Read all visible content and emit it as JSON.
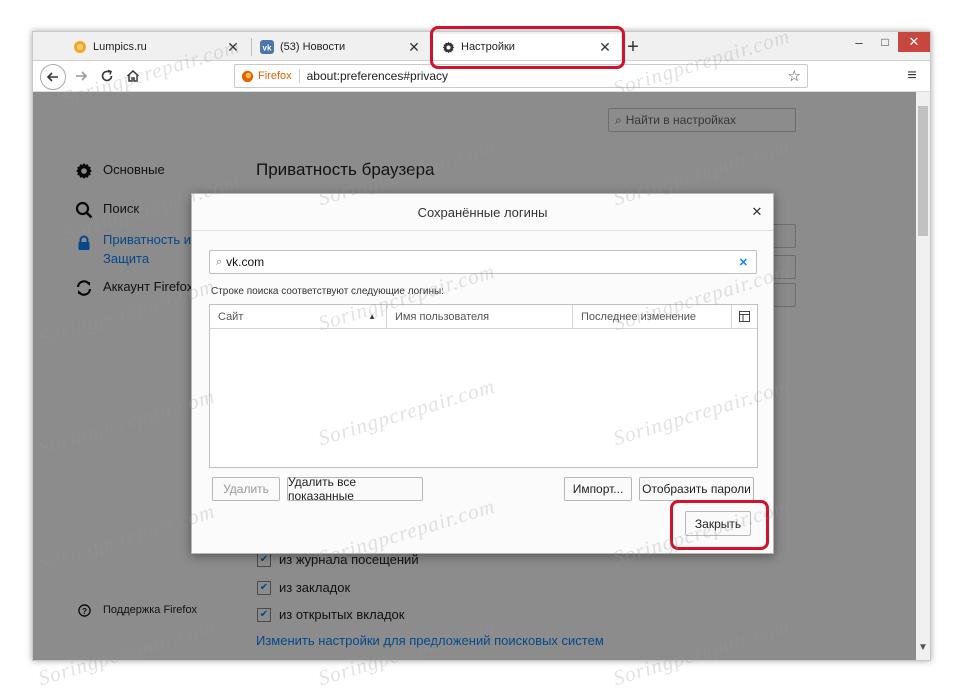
{
  "tabs": [
    {
      "title": "Lumpics.ru",
      "icon": "lumpics-favicon"
    },
    {
      "title": "(53) Новости",
      "icon": "vk-favicon"
    },
    {
      "title": "Настройки",
      "icon": "gear-icon"
    }
  ],
  "new_tab_label": "+",
  "window_controls": {
    "minimize": "–",
    "maximize": "□",
    "close": "✕"
  },
  "url": {
    "brand": "Firefox",
    "address": "about:preferences#privacy"
  },
  "menu_icon": "≡",
  "search_settings_placeholder": "Найти в настройках",
  "sidebar": {
    "items": [
      {
        "label": "Основные",
        "icon": "gear-icon"
      },
      {
        "label": "Поиск",
        "icon": "search-icon"
      },
      {
        "label": "Приватность и Защита",
        "icon": "lock-icon"
      },
      {
        "label": "Аккаунт Firefox",
        "icon": "sync-icon"
      }
    ],
    "support": "Поддержка Firefox"
  },
  "main": {
    "heading": "Приватность браузера",
    "checkboxes": [
      {
        "label": "из журнала посещений",
        "checked": true
      },
      {
        "label": "из закладок",
        "checked": true
      },
      {
        "label": "из открытых вкладок",
        "checked": true
      }
    ],
    "link": "Изменить настройки для предложений поисковых систем"
  },
  "dialog": {
    "title": "Сохранённые логины",
    "search_value": "vk.com",
    "hint": "Строке поиска соответствуют следующие логины:",
    "columns": [
      "Сайт",
      "Имя пользователя",
      "Последнее изменение"
    ],
    "rows": [],
    "buttons": {
      "remove": "Удалить",
      "remove_all": "Удалить все показанные",
      "import": "Импорт...",
      "show_passwords": "Отобразить пароли",
      "close": "Закрыть"
    }
  },
  "watermark": "Soringpcrepair.com",
  "colors": {
    "accent": "#0a84ff",
    "highlight": "#d2112a",
    "firefox": "#e66000"
  }
}
